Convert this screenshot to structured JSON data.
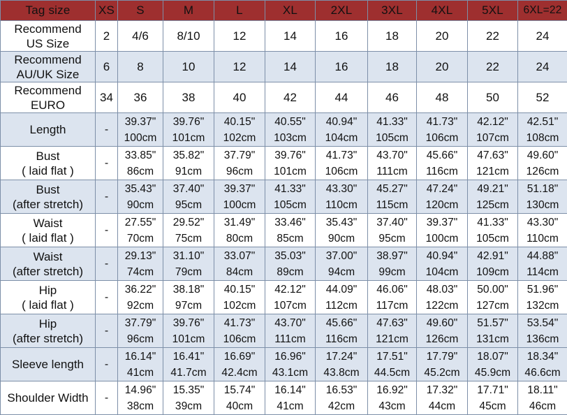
{
  "colors": {
    "header_bg": "#9e2f2f",
    "header_text": "#ffffff",
    "row_blue": "#dce4ef",
    "row_white": "#ffffff",
    "border": "#7d8fa8",
    "text": "#111111"
  },
  "chart_data": {
    "type": "table",
    "title": "Tag size",
    "columns": [
      "Tag size",
      "XS",
      "S",
      "M",
      "L",
      "XL",
      "2XL",
      "3XL",
      "4XL",
      "5XL",
      "6XL=22"
    ],
    "rows": [
      {
        "label": "Recommend US Size",
        "values": [
          "2",
          "4/6",
          "8/10",
          "12",
          "14",
          "16",
          "18",
          "20",
          "22",
          "24"
        ]
      },
      {
        "label": "Recommend AU/UK Size",
        "values": [
          "6",
          "8",
          "10",
          "12",
          "14",
          "16",
          "18",
          "20",
          "22",
          "24"
        ]
      },
      {
        "label": "Recommend EURO",
        "values": [
          "34",
          "36",
          "38",
          "40",
          "42",
          "44",
          "46",
          "48",
          "50",
          "52"
        ]
      },
      {
        "label": "Length",
        "values": [
          "-",
          "39.37\"/100cm",
          "39.76\"/101cm",
          "40.15\"/102cm",
          "40.55\"/103cm",
          "40.94\"/104cm",
          "41.33\"/105cm",
          "41.73\"/106cm",
          "42.12\"/107cm",
          "42.51\"/108cm"
        ]
      },
      {
        "label": "Bust ( laid flat )",
        "values": [
          "-",
          "33.85\"/86cm",
          "35.82\"/91cm",
          "37.79\"/96cm",
          "39.76\"/101cm",
          "41.73\"/106cm",
          "43.70\"/111cm",
          "45.66\"/116cm",
          "47.63\"/121cm",
          "49.60\"/126cm"
        ]
      },
      {
        "label": "Bust (after stretch)",
        "values": [
          "-",
          "35.43\"/90cm",
          "37.40\"/95cm",
          "39.37\"/100cm",
          "41.33\"/105cm",
          "43.30\"/110cm",
          "45.27\"/115cm",
          "47.24\"/120cm",
          "49.21\"/125cm",
          "51.18\"/130cm"
        ]
      },
      {
        "label": "Waist ( laid flat )",
        "values": [
          "-",
          "27.55\"/70cm",
          "29.52\"/75cm",
          "31.49\"/80cm",
          "33.46\"/85cm",
          "35.43\"/90cm",
          "37.40\"/95cm",
          "39.37\"/100cm",
          "41.33\"/105cm",
          "43.30\"/110cm"
        ]
      },
      {
        "label": "Waist (after stretch)",
        "values": [
          "-",
          "29.13\"/74cm",
          "31.10\"/79cm",
          "33.07\"/84cm",
          "35.03\"/89cm",
          "37.00\"/94cm",
          "38.97\"/99cm",
          "40.94\"/104cm",
          "42.91\"/109cm",
          "44.88\"/114cm"
        ]
      },
      {
        "label": "Hip ( laid flat )",
        "values": [
          "-",
          "36.22\"/92cm",
          "38.18\"/97cm",
          "40.15\"/102cm",
          "42.12\"/107cm",
          "44.09\"/112cm",
          "46.06\"/117cm",
          "48.03\"/122cm",
          "50.00\"/127cm",
          "51.96\"/132cm"
        ]
      },
      {
        "label": "Hip (after stretch)",
        "values": [
          "-",
          "37.79\"/96cm",
          "39.76\"/101cm",
          "41.73\"/106cm",
          "43.70\"/111cm",
          "45.66\"/116cm",
          "47.63\"/121cm",
          "49.60\"/126cm",
          "51.57\"/131cm",
          "53.54\"/136cm"
        ]
      },
      {
        "label": "Sleeve length",
        "values": [
          "-",
          "16.14\"/41cm",
          "16.41\"/41.7cm",
          "16.69\"/42.4cm",
          "16.96\"/43.1cm",
          "17.24\"/43.8cm",
          "17.51\"/44.5cm",
          "17.79\"/45.2cm",
          "18.07\"/45.9cm",
          "18.34\"/46.6cm"
        ]
      },
      {
        "label": "Shoulder Width",
        "values": [
          "-",
          "14.96\"/38cm",
          "15.35\"/39cm",
          "15.74\"/40cm",
          "16.14\"/41cm",
          "16.53\"/42cm",
          "16.92\"/43cm",
          "17.32\"/44cm",
          "17.71\"/45cm",
          "18.11\"/46cm"
        ]
      }
    ]
  },
  "header": {
    "label": "Tag size",
    "sizes": [
      "XS",
      "S",
      "M",
      "L",
      "XL",
      "2XL",
      "3XL",
      "4XL",
      "5XL",
      "6XL=22"
    ]
  },
  "rows": [
    {
      "name": "recommend-us-size",
      "band": "white",
      "kind": "size",
      "label_line1": "Recommend",
      "label_line2": "US Size",
      "cells": [
        "2",
        "4/6",
        "8/10",
        "12",
        "14",
        "16",
        "18",
        "20",
        "22",
        "24"
      ]
    },
    {
      "name": "recommend-au-uk-size",
      "band": "blue",
      "kind": "size",
      "label_line1": "Recommend",
      "label_line2": "AU/UK Size",
      "cells": [
        "6",
        "8",
        "10",
        "12",
        "14",
        "16",
        "18",
        "20",
        "22",
        "24"
      ]
    },
    {
      "name": "recommend-euro",
      "band": "white",
      "kind": "size",
      "label_line1": "Recommend",
      "label_line2": "EURO",
      "cells": [
        "34",
        "36",
        "38",
        "40",
        "42",
        "44",
        "46",
        "48",
        "50",
        "52"
      ]
    },
    {
      "name": "length",
      "band": "blue",
      "kind": "meas",
      "label_line1": "Length",
      "label_line2": "",
      "dash": "-",
      "inch": [
        "39.37\"",
        "39.76\"",
        "40.15\"",
        "40.55\"",
        "40.94\"",
        "41.33\"",
        "41.73\"",
        "42.12\"",
        "42.51\""
      ],
      "cm": [
        "100cm",
        "101cm",
        "102cm",
        "103cm",
        "104cm",
        "105cm",
        "106cm",
        "107cm",
        "108cm"
      ]
    },
    {
      "name": "bust-laid-flat",
      "band": "white",
      "kind": "meas",
      "label_line1": "Bust",
      "label_line2": "( laid flat )",
      "dash": "-",
      "inch": [
        "33.85\"",
        "35.82\"",
        "37.79\"",
        "39.76\"",
        "41.73\"",
        "43.70\"",
        "45.66\"",
        "47.63\"",
        "49.60\""
      ],
      "cm": [
        "86cm",
        "91cm",
        "96cm",
        "101cm",
        "106cm",
        "111cm",
        "116cm",
        "121cm",
        "126cm"
      ]
    },
    {
      "name": "bust-after-stretch",
      "band": "blue",
      "kind": "meas",
      "label_line1": "Bust",
      "label_line2": "(after stretch)",
      "dash": "-",
      "inch": [
        "35.43\"",
        "37.40\"",
        "39.37\"",
        "41.33\"",
        "43.30\"",
        "45.27\"",
        "47.24\"",
        "49.21\"",
        "51.18\""
      ],
      "cm": [
        "90cm",
        "95cm",
        "100cm",
        "105cm",
        "110cm",
        "115cm",
        "120cm",
        "125cm",
        "130cm"
      ]
    },
    {
      "name": "waist-laid-flat",
      "band": "white",
      "kind": "meas",
      "label_line1": "Waist",
      "label_line2": "( laid flat )",
      "dash": "-",
      "inch": [
        "27.55\"",
        "29.52\"",
        "31.49\"",
        "33.46\"",
        "35.43\"",
        "37.40\"",
        "39.37\"",
        "41.33\"",
        "43.30\""
      ],
      "cm": [
        "70cm",
        "75cm",
        "80cm",
        "85cm",
        "90cm",
        "95cm",
        "100cm",
        "105cm",
        "110cm"
      ]
    },
    {
      "name": "waist-after-stretch",
      "band": "blue",
      "kind": "meas",
      "label_line1": "Waist",
      "label_line2": "(after stretch)",
      "dash": "-",
      "inch": [
        "29.13\"",
        "31.10\"",
        "33.07\"",
        "35.03\"",
        "37.00\"",
        "38.97\"",
        "40.94\"",
        "42.91\"",
        "44.88\""
      ],
      "cm": [
        "74cm",
        "79cm",
        "84cm",
        "89cm",
        "94cm",
        "99cm",
        "104cm",
        "109cm",
        "114cm"
      ]
    },
    {
      "name": "hip-laid-flat",
      "band": "white",
      "kind": "meas",
      "label_line1": "Hip",
      "label_line2": "( laid flat )",
      "dash": "-",
      "inch": [
        "36.22\"",
        "38.18\"",
        "40.15\"",
        "42.12\"",
        "44.09\"",
        "46.06\"",
        "48.03\"",
        "50.00\"",
        "51.96\""
      ],
      "cm": [
        "92cm",
        "97cm",
        "102cm",
        "107cm",
        "112cm",
        "117cm",
        "122cm",
        "127cm",
        "132cm"
      ]
    },
    {
      "name": "hip-after-stretch",
      "band": "blue",
      "kind": "meas",
      "label_line1": "Hip",
      "label_line2": "(after stretch)",
      "dash": "-",
      "inch": [
        "37.79\"",
        "39.76\"",
        "41.73\"",
        "43.70\"",
        "45.66\"",
        "47.63\"",
        "49.60\"",
        "51.57\"",
        "53.54\""
      ],
      "cm": [
        "96cm",
        "101cm",
        "106cm",
        "111cm",
        "116cm",
        "121cm",
        "126cm",
        "131cm",
        "136cm"
      ]
    },
    {
      "name": "sleeve-length",
      "band": "blue",
      "kind": "meas",
      "label_line1": "Sleeve length",
      "label_line2": "",
      "dash": "-",
      "inch": [
        "16.14\"",
        "16.41\"",
        "16.69\"",
        "16.96\"",
        "17.24\"",
        "17.51\"",
        "17.79\"",
        "18.07\"",
        "18.34\""
      ],
      "cm": [
        "41cm",
        "41.7cm",
        "42.4cm",
        "43.1cm",
        "43.8cm",
        "44.5cm",
        "45.2cm",
        "45.9cm",
        "46.6cm"
      ]
    },
    {
      "name": "shoulder-width",
      "band": "white",
      "kind": "meas",
      "label_line1": "Shoulder Width",
      "label_line2": "",
      "dash": "-",
      "inch": [
        "14.96\"",
        "15.35\"",
        "15.74\"",
        "16.14\"",
        "16.53\"",
        "16.92\"",
        "17.32\"",
        "17.71\"",
        "18.11\""
      ],
      "cm": [
        "38cm",
        "39cm",
        "40cm",
        "41cm",
        "42cm",
        "43cm",
        "44cm",
        "45cm",
        "46cm"
      ]
    }
  ]
}
